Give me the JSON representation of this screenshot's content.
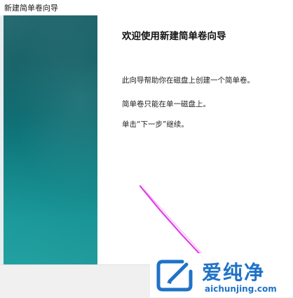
{
  "window": {
    "title": "新建简单卷向导"
  },
  "wizard": {
    "heading": "欢迎使用新建简单卷向导",
    "paragraphs": [
      "此向导帮助你在磁盘上创建一个简单卷。",
      "简单卷只能在单一磁盘上。",
      "单击“下一步”继续。"
    ]
  },
  "watermark": {
    "brand": "爱纯净",
    "url": "aichunjing.com"
  },
  "colors": {
    "sidebar_top": "#0f5d63",
    "sidebar_bottom": "#24a8a8",
    "annotation_arrow": "#e43ee8",
    "brand_blue": "#1f72c7"
  }
}
